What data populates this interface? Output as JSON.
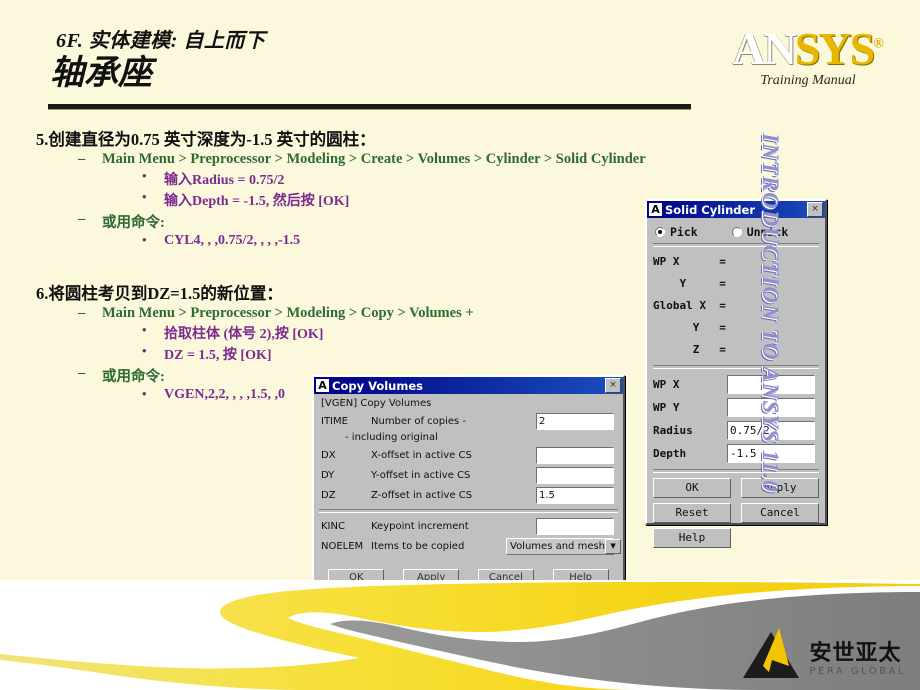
{
  "slide": {
    "title_line1": "6F. 实体建模: 自上而下",
    "title_line2": "轴承座",
    "vertical_banner": "INTRODUCTION TO ANSYS 11.0",
    "background_color": "#fbf8dc"
  },
  "logo": {
    "ansys_part1": "AN",
    "ansys_part2": "SYS",
    "registered_mark": "®",
    "subtitle": "Training Manual"
  },
  "outline": [
    {
      "level": 1,
      "text": "5.创建直径为0.75 英寸深度为-1.5 英寸的圆柱："
    },
    {
      "level": 2,
      "text": "Main Menu > Preprocessor > Modeling > Create > Volumes > Cylinder > Solid Cylinder"
    },
    {
      "level": 3,
      "text": "输入Radius = 0.75/2"
    },
    {
      "level": 3,
      "text": "输入Depth = -1.5, 然后按 [OK]"
    },
    {
      "level": 2,
      "text": "或用命令:"
    },
    {
      "level": 3,
      "text": "CYL4, , ,0.75/2, , , ,-1.5"
    },
    {
      "level": 1,
      "text": "6.将圆柱考贝到DZ=1.5的新位置："
    },
    {
      "level": 2,
      "text": "Main Menu > Preprocessor > Modeling > Copy > Volumes +"
    },
    {
      "level": 3,
      "text": "拾取柱体 (体号 2),按 [OK]"
    },
    {
      "level": 3,
      "text": "DZ = 1.5, 按 [OK]"
    },
    {
      "level": 2,
      "text": "或用命令:"
    },
    {
      "level": 3,
      "text": "VGEN,2,2, , , ,1.5, ,0"
    }
  ],
  "solid_cylinder_dialog": {
    "title": "Solid Cylinder",
    "window_icon": "A",
    "close_label": "×",
    "pick_label": "Pick",
    "unpick_label": "Unpick",
    "pick_selected": true,
    "coord_rows": [
      "WP X      =",
      "    Y     =",
      "Global X  =",
      "      Y   =",
      "      Z   ="
    ],
    "fields": [
      {
        "label": "WP X",
        "value": ""
      },
      {
        "label": "WP Y",
        "value": ""
      },
      {
        "label": "Radius",
        "value": "0.75/2"
      },
      {
        "label": "Depth",
        "value": "-1.5"
      }
    ],
    "buttons": [
      "OK",
      "Apply",
      "Reset",
      "Cancel",
      "Help"
    ]
  },
  "copy_volumes_dialog": {
    "title": "Copy Volumes",
    "window_icon": "A",
    "close_label": "×",
    "command_header": "[VGEN]  Copy Volumes",
    "rows": [
      {
        "code": "ITIME",
        "desc": "Number of copies -",
        "value": "2",
        "type": "text"
      },
      {
        "code": "DX",
        "desc": "X-offset in active CS",
        "value": "",
        "type": "text"
      },
      {
        "code": "DY",
        "desc": "Y-offset in active CS",
        "value": "",
        "type": "text"
      },
      {
        "code": "DZ",
        "desc": "Z-offset in active CS",
        "value": "1.5",
        "type": "text"
      },
      {
        "code": "KINC",
        "desc": "Keypoint increment",
        "value": "",
        "type": "text"
      },
      {
        "code": "NOELEM",
        "desc": "Items to be copied",
        "value": "Volumes and mesh",
        "type": "select"
      }
    ],
    "sub_note": "- including original",
    "buttons": [
      "OK",
      "Apply",
      "Cancel",
      "Help"
    ]
  },
  "pera_logo": {
    "chinese": "安世亚太",
    "english": "PERA GLOBAL"
  }
}
